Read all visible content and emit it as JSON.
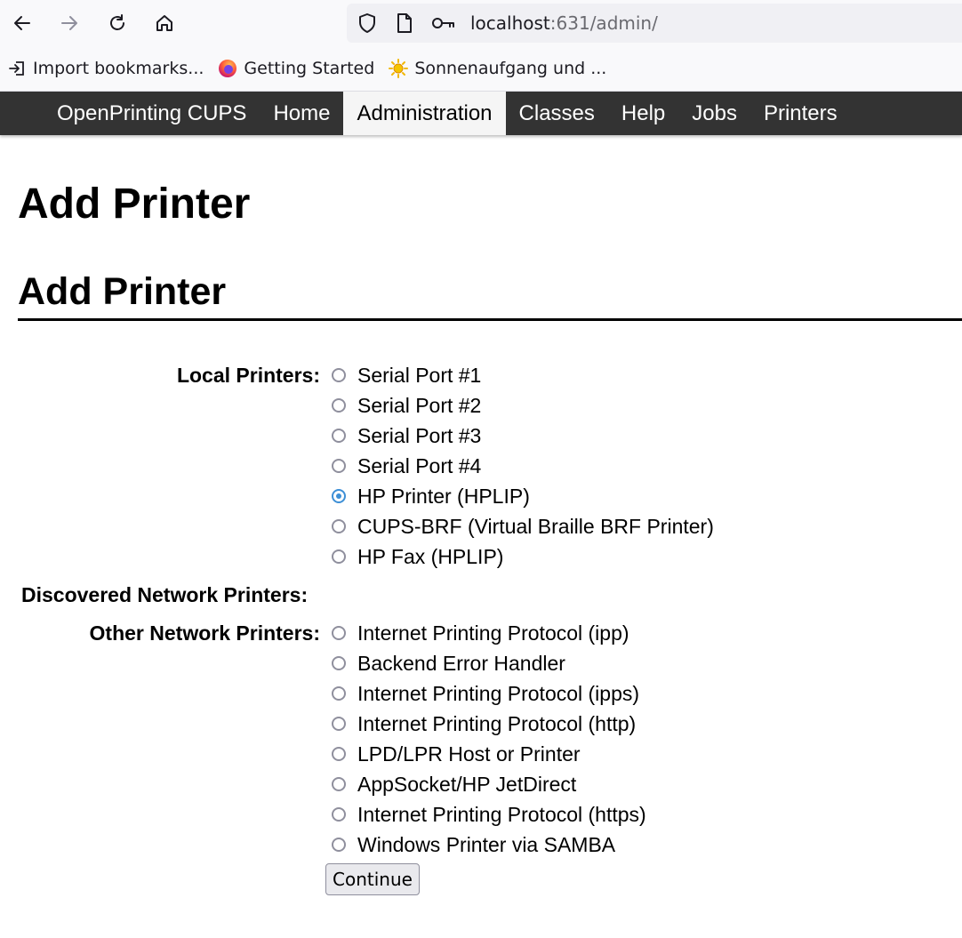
{
  "browser": {
    "url_host": "localhost",
    "url_path": ":631/admin/",
    "bookmarks": [
      {
        "label": "Import bookmarks...",
        "icon": "import-icon"
      },
      {
        "label": "Getting Started",
        "icon": "firefox-icon"
      },
      {
        "label": "Sonnenaufgang und ...",
        "icon": "sun-icon"
      }
    ]
  },
  "header": {
    "brand": "OpenPrinting CUPS",
    "nav": [
      "Home",
      "Administration",
      "Classes",
      "Help",
      "Jobs",
      "Printers"
    ],
    "active": "Administration"
  },
  "page": {
    "title": "Add Printer",
    "section_title": "Add Printer"
  },
  "form": {
    "local_label": "Local Printers:",
    "local_options": [
      {
        "label": "Serial Port #1",
        "checked": false
      },
      {
        "label": "Serial Port #2",
        "checked": false
      },
      {
        "label": "Serial Port #3",
        "checked": false
      },
      {
        "label": "Serial Port #4",
        "checked": false
      },
      {
        "label": "HP Printer (HPLIP)",
        "checked": true
      },
      {
        "label": "CUPS-BRF (Virtual Braille BRF Printer)",
        "checked": false
      },
      {
        "label": "HP Fax (HPLIP)",
        "checked": false
      }
    ],
    "discovered_label": "Discovered Network Printers:",
    "other_label": "Other Network Printers:",
    "other_options": [
      {
        "label": "Internet Printing Protocol (ipp)",
        "checked": false
      },
      {
        "label": "Backend Error Handler",
        "checked": false
      },
      {
        "label": "Internet Printing Protocol (ipps)",
        "checked": false
      },
      {
        "label": "Internet Printing Protocol (http)",
        "checked": false
      },
      {
        "label": "LPD/LPR Host or Printer",
        "checked": false
      },
      {
        "label": "AppSocket/HP JetDirect",
        "checked": false
      },
      {
        "label": "Internet Printing Protocol (https)",
        "checked": false
      },
      {
        "label": "Windows Printer via SAMBA",
        "checked": false
      }
    ],
    "continue_label": "Continue"
  }
}
